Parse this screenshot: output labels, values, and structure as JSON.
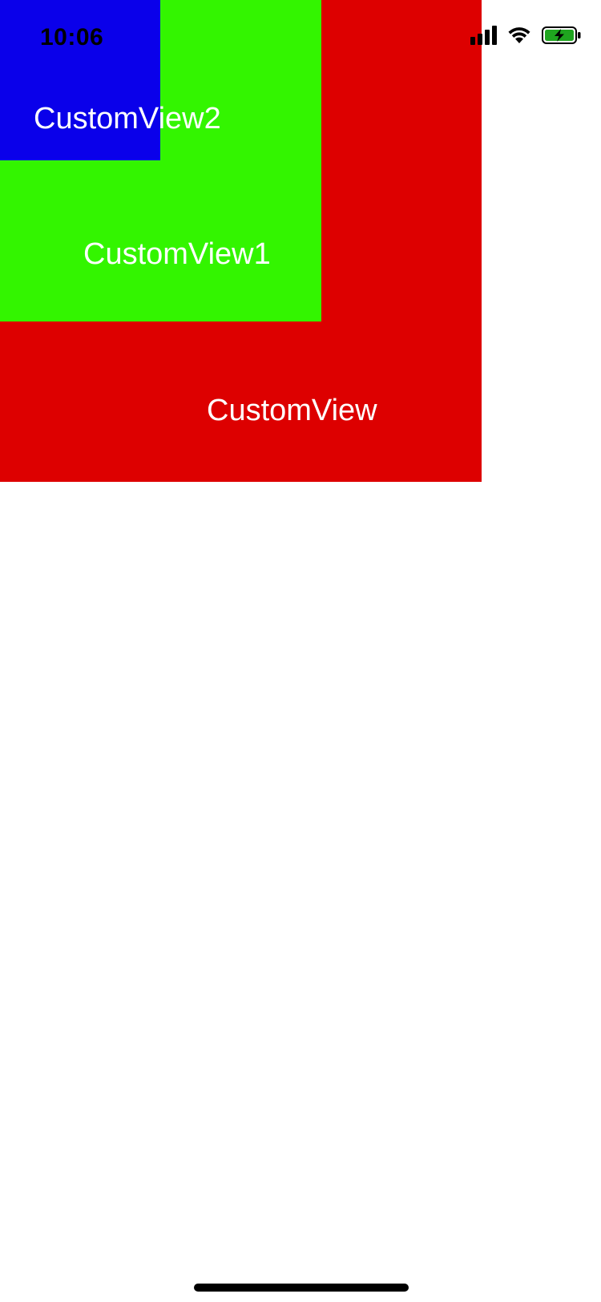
{
  "status_bar": {
    "time": "10:06",
    "signal_icon": "cellular-signal-icon",
    "wifi_icon": "wifi-icon",
    "battery_icon": "battery-charging-icon",
    "battery_color": "#1fa51f"
  },
  "views": {
    "outer": {
      "label": "CustomView",
      "color": "#dd0000"
    },
    "middle": {
      "label": "CustomView1",
      "color": "#33f500"
    },
    "inner": {
      "label": "CustomView2",
      "color": "#0a00ea"
    }
  },
  "home_indicator": {
    "icon": "home-indicator-bar"
  }
}
